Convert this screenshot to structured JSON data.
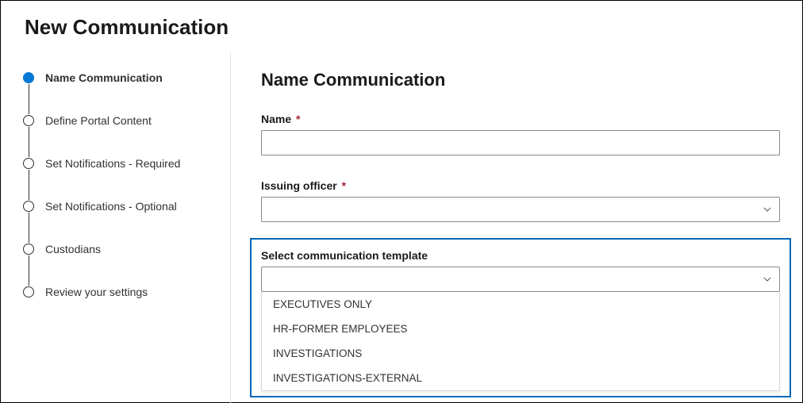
{
  "pageTitle": "New Communication",
  "steps": [
    {
      "label": "Name Communication",
      "active": true
    },
    {
      "label": "Define Portal Content",
      "active": false
    },
    {
      "label": "Set Notifications - Required",
      "active": false
    },
    {
      "label": "Set Notifications - Optional",
      "active": false
    },
    {
      "label": "Custodians",
      "active": false
    },
    {
      "label": "Review your settings",
      "active": false
    }
  ],
  "main": {
    "heading": "Name Communication",
    "nameField": {
      "label": "Name",
      "required": "*",
      "value": ""
    },
    "officerField": {
      "label": "Issuing officer",
      "required": "*",
      "value": ""
    },
    "templateField": {
      "label": "Select communication template",
      "value": "",
      "options": [
        "EXECUTIVES ONLY",
        "HR-FORMER EMPLOYEES",
        "INVESTIGATIONS",
        "INVESTIGATIONS-EXTERNAL"
      ]
    }
  }
}
